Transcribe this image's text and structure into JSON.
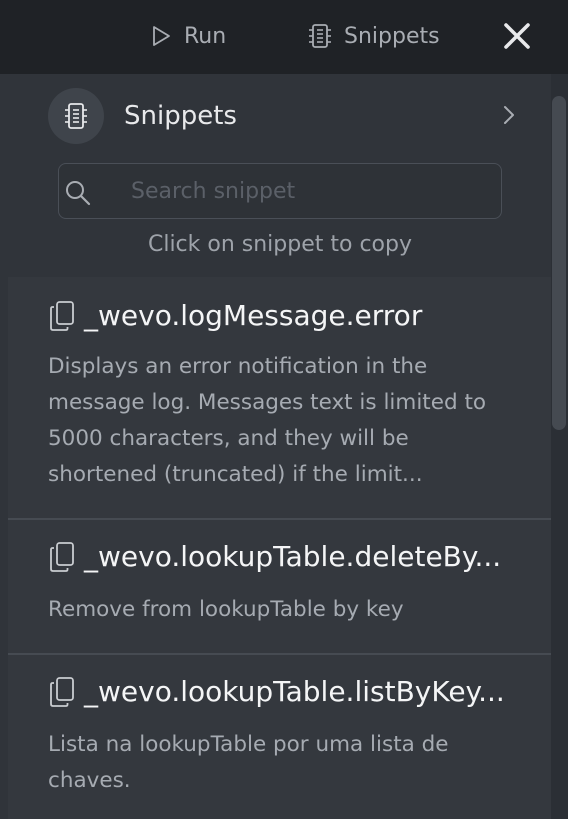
{
  "toolbar": {
    "run_label": "Run",
    "snippets_label": "Snippets"
  },
  "header": {
    "title": "Snippets"
  },
  "search": {
    "placeholder": "Search snippet",
    "value": ""
  },
  "hint": "Click on snippet to copy",
  "snippets": [
    {
      "title": "_wevo.logMessage.error",
      "description": "Displays an error notification in the message log. Messages text is limited to 5000 characters, and they will be shortened (truncated) if the limit..."
    },
    {
      "title": "_wevo.lookupTable.deleteBy...",
      "description": "Remove from lookupTable by key"
    },
    {
      "title": "_wevo.lookupTable.listByKey...",
      "description": "Lista na lookupTable por uma lista de chaves."
    }
  ],
  "colors": {
    "topbar_bg": "#1f2226",
    "panel_bg": "#30343a",
    "card_bg": "#34383e",
    "text_primary": "#f4f5f6",
    "text_secondary": "#a6abb2"
  }
}
